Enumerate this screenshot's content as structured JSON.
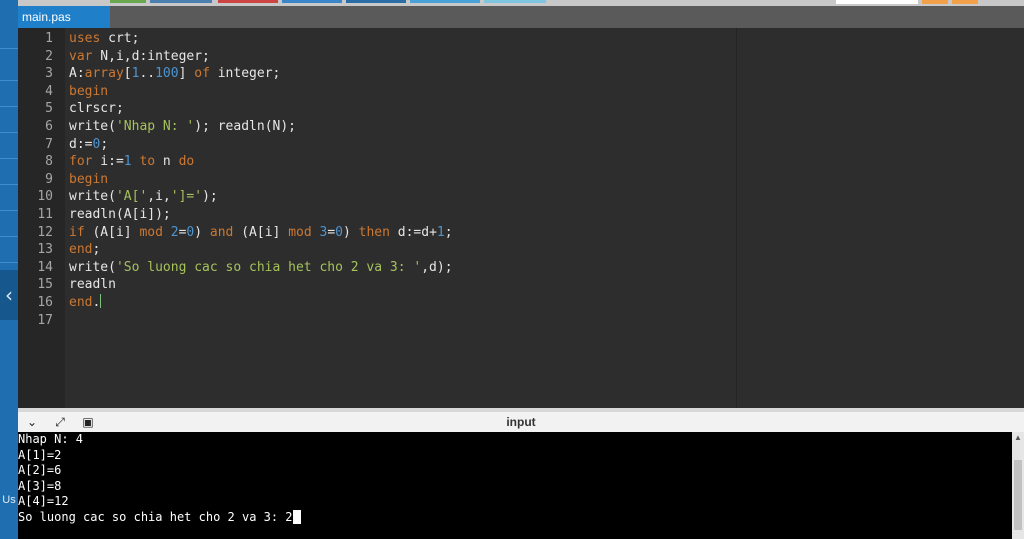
{
  "tab": {
    "label": "main.pas"
  },
  "console": {
    "title": "input",
    "lines": [
      "Nhap N: 4",
      "A[1]=2",
      "A[2]=6",
      "A[3]=8",
      "A[4]=12",
      "So luong cac so chia het cho 2 va 3: 2"
    ]
  },
  "left_rail": {
    "arrow_icon": "chevron-left-icon",
    "label_fragment": "Us"
  },
  "editor": {
    "line_numbers": [
      "1",
      "2",
      "3",
      "4",
      "5",
      "6",
      "7",
      "8",
      "9",
      "10",
      "11",
      "12",
      "13",
      "14",
      "15",
      "16",
      "17"
    ],
    "lines": [
      [
        {
          "t": "kw",
          "s": "uses"
        },
        {
          "t": "id",
          "s": " crt;"
        }
      ],
      [
        {
          "t": "kw",
          "s": "var"
        },
        {
          "t": "id",
          "s": " N,i,d:integer;"
        }
      ],
      [
        {
          "t": "id",
          "s": "A:"
        },
        {
          "t": "kw",
          "s": "array"
        },
        {
          "t": "id",
          "s": "["
        },
        {
          "t": "num",
          "s": "1"
        },
        {
          "t": "id",
          "s": ".."
        },
        {
          "t": "num",
          "s": "100"
        },
        {
          "t": "id",
          "s": "] "
        },
        {
          "t": "kw",
          "s": "of"
        },
        {
          "t": "id",
          "s": " integer;"
        }
      ],
      [
        {
          "t": "kw",
          "s": "begin"
        }
      ],
      [
        {
          "t": "id",
          "s": "clrscr;"
        }
      ],
      [
        {
          "t": "id",
          "s": "write("
        },
        {
          "t": "str",
          "s": "'Nhap N: '"
        },
        {
          "t": "id",
          "s": "); readln(N);"
        }
      ],
      [
        {
          "t": "id",
          "s": "d:="
        },
        {
          "t": "num",
          "s": "0"
        },
        {
          "t": "id",
          "s": ";"
        }
      ],
      [
        {
          "t": "kw",
          "s": "for"
        },
        {
          "t": "id",
          "s": " i:="
        },
        {
          "t": "num",
          "s": "1"
        },
        {
          "t": "id",
          "s": " "
        },
        {
          "t": "kw",
          "s": "to"
        },
        {
          "t": "id",
          "s": " n "
        },
        {
          "t": "kw",
          "s": "do"
        }
      ],
      [
        {
          "t": "kw",
          "s": "begin"
        }
      ],
      [
        {
          "t": "id",
          "s": "write("
        },
        {
          "t": "str",
          "s": "'A['"
        },
        {
          "t": "id",
          "s": ",i,"
        },
        {
          "t": "str",
          "s": "']='"
        },
        {
          "t": "id",
          "s": ");"
        }
      ],
      [
        {
          "t": "id",
          "s": "readln(A[i]);"
        }
      ],
      [
        {
          "t": "kw",
          "s": "if"
        },
        {
          "t": "id",
          "s": " (A[i] "
        },
        {
          "t": "kw",
          "s": "mod"
        },
        {
          "t": "id",
          "s": " "
        },
        {
          "t": "num",
          "s": "2"
        },
        {
          "t": "id",
          "s": "="
        },
        {
          "t": "num",
          "s": "0"
        },
        {
          "t": "id",
          "s": ") "
        },
        {
          "t": "kw",
          "s": "and"
        },
        {
          "t": "id",
          "s": " (A[i] "
        },
        {
          "t": "kw",
          "s": "mod"
        },
        {
          "t": "id",
          "s": " "
        },
        {
          "t": "num",
          "s": "3"
        },
        {
          "t": "id",
          "s": "="
        },
        {
          "t": "num",
          "s": "0"
        },
        {
          "t": "id",
          "s": ") "
        },
        {
          "t": "kw",
          "s": "then"
        },
        {
          "t": "id",
          "s": " d:=d+"
        },
        {
          "t": "num",
          "s": "1"
        },
        {
          "t": "id",
          "s": ";"
        }
      ],
      [
        {
          "t": "kw",
          "s": "end"
        },
        {
          "t": "id",
          "s": ";"
        }
      ],
      [
        {
          "t": "id",
          "s": "write("
        },
        {
          "t": "str",
          "s": "'So luong cac so chia het cho 2 va 3: '"
        },
        {
          "t": "id",
          "s": ",d);"
        }
      ],
      [
        {
          "t": "id",
          "s": "readln"
        }
      ],
      [
        {
          "t": "kw",
          "s": "end"
        },
        {
          "t": "id",
          "s": "."
        }
      ],
      []
    ]
  },
  "colors": {
    "keyword": "#cc7832",
    "string": "#a5c25c",
    "number": "#4e94ce",
    "identifier": "#e6e6e6",
    "tab_active": "#1f7fc8",
    "console_bg": "#000000"
  },
  "console_controls": {
    "collapse_icon": "chevron-down-icon",
    "expand_icon": "expand-arrows-icon",
    "save_icon": "save-icon"
  }
}
